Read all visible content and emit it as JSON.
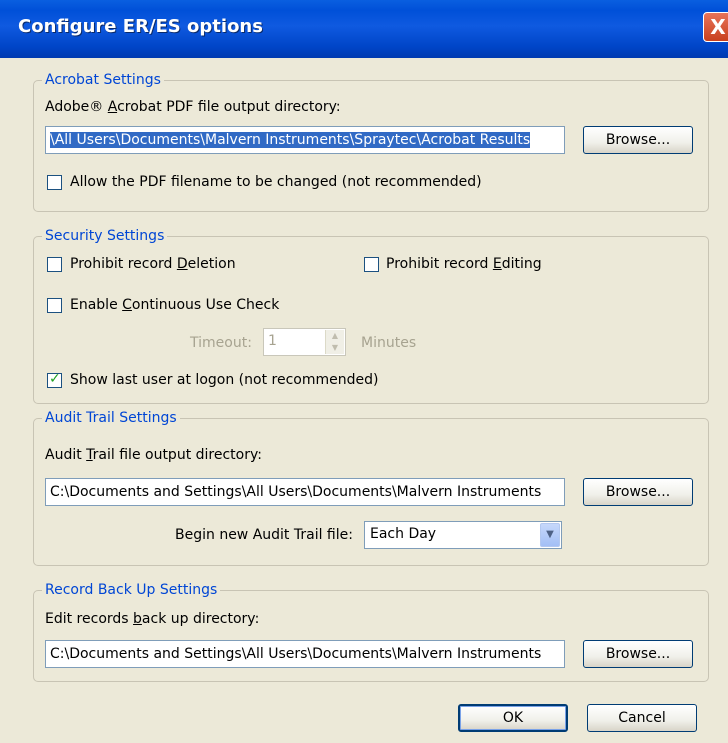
{
  "window": {
    "title": "Configure ER/ES options",
    "close_glyph": "X"
  },
  "acrobat": {
    "legend": "Acrobat Settings",
    "dir_label_pre": "Adobe® ",
    "dir_label_u": "A",
    "dir_label_post": "crobat PDF file output directory:",
    "dir_value": "\\All Users\\Documents\\Malvern Instruments\\Spraytec\\Acrobat Results",
    "browse": "Browse...",
    "allow_rename": {
      "label": "Allow the PDF filename to be changed (not recommended)",
      "checked": false
    }
  },
  "security": {
    "legend": "Security Settings",
    "prohibit_deletion": {
      "pre": "Prohibit record ",
      "u": "D",
      "post": "eletion",
      "checked": false
    },
    "prohibit_editing": {
      "pre": "Prohibit record ",
      "u": "E",
      "post": "diting",
      "checked": false
    },
    "continuous_use": {
      "pre": "Enable ",
      "u": "C",
      "post": "ontinuous Use Check",
      "checked": false
    },
    "timeout_label": "Timeout:",
    "timeout_value": "1",
    "timeout_unit": "Minutes",
    "show_last_user": {
      "label": "Show last user at logon (not recommended)",
      "checked": true
    }
  },
  "audit": {
    "legend": "Audit Trail Settings",
    "dir_pre": "Audit ",
    "dir_u": "T",
    "dir_post": "rail file output directory:",
    "dir_value": "C:\\Documents and Settings\\All Users\\Documents\\Malvern Instruments",
    "browse": "Browse...",
    "begin_label": "Begin new Audit Trail file:",
    "begin_value": "Each Day"
  },
  "backup": {
    "legend": "Record Back Up Settings",
    "dir_pre": "Edit records ",
    "dir_u": "b",
    "dir_post": "ack up directory:",
    "dir_value": "C:\\Documents and Settings\\All Users\\Documents\\Malvern Instruments",
    "browse": "Browse..."
  },
  "footer": {
    "ok": "OK",
    "cancel": "Cancel"
  },
  "colors": {
    "title_bar": "#0050d8",
    "legend_text": "#0046d5",
    "dialog_bg": "#ece9d8",
    "selection": "#316ac5"
  }
}
